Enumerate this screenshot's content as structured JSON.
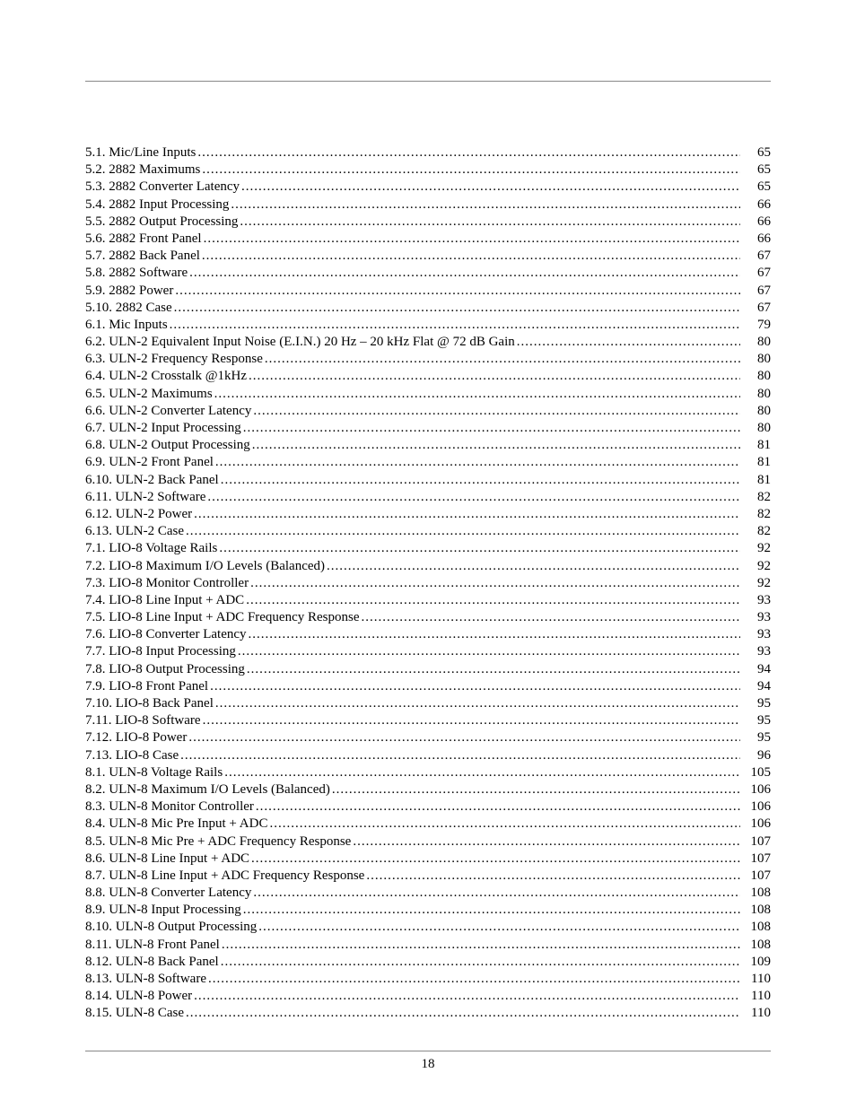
{
  "entries": [
    {
      "label": "5.1. Mic/Line Inputs",
      "page": "65"
    },
    {
      "label": "5.2. 2882 Maximums",
      "page": "65"
    },
    {
      "label": "5.3. 2882 Converter Latency",
      "page": "65"
    },
    {
      "label": "5.4. 2882 Input Processing",
      "page": "66"
    },
    {
      "label": "5.5. 2882 Output Processing",
      "page": "66"
    },
    {
      "label": "5.6. 2882 Front Panel",
      "page": "66"
    },
    {
      "label": "5.7. 2882 Back Panel",
      "page": "67"
    },
    {
      "label": "5.8. 2882 Software",
      "page": "67"
    },
    {
      "label": "5.9. 2882 Power",
      "page": "67"
    },
    {
      "label": "5.10. 2882 Case",
      "page": "67"
    },
    {
      "label": "6.1. Mic Inputs",
      "page": "79"
    },
    {
      "label": "6.2. ULN-2 Equivalent Input Noise (E.I.N.) 20 Hz – 20 kHz Flat @ 72 dB Gain",
      "page": "80"
    },
    {
      "label": "6.3. ULN-2 Frequency Response",
      "page": "80"
    },
    {
      "label": "6.4. ULN-2 Crosstalk @1kHz",
      "page": "80"
    },
    {
      "label": "6.5. ULN-2 Maximums",
      "page": "80"
    },
    {
      "label": "6.6. ULN-2 Converter Latency",
      "page": "80"
    },
    {
      "label": "6.7. ULN-2 Input Processing",
      "page": "80"
    },
    {
      "label": "6.8. ULN-2 Output Processing",
      "page": "81"
    },
    {
      "label": "6.9. ULN-2 Front Panel",
      "page": "81"
    },
    {
      "label": "6.10. ULN-2 Back Panel",
      "page": "81"
    },
    {
      "label": "6.11. ULN-2 Software",
      "page": "82"
    },
    {
      "label": "6.12. ULN-2 Power",
      "page": "82"
    },
    {
      "label": "6.13. ULN-2 Case",
      "page": "82"
    },
    {
      "label": "7.1. LIO-8 Voltage Rails",
      "page": "92"
    },
    {
      "label": "7.2. LIO-8 Maximum I/O Levels (Balanced)",
      "page": "92"
    },
    {
      "label": "7.3. LIO-8 Monitor Controller",
      "page": "92"
    },
    {
      "label": "7.4. LIO-8 Line Input + ADC",
      "page": "93"
    },
    {
      "label": "7.5. LIO-8 Line Input + ADC Frequency Response",
      "page": "93"
    },
    {
      "label": "7.6. LIO-8 Converter Latency",
      "page": "93"
    },
    {
      "label": "7.7. LIO-8 Input Processing",
      "page": "93"
    },
    {
      "label": "7.8. LIO-8 Output Processing",
      "page": "94"
    },
    {
      "label": "7.9. LIO-8 Front Panel",
      "page": "94"
    },
    {
      "label": "7.10. LIO-8 Back Panel",
      "page": "95"
    },
    {
      "label": "7.11. LIO-8 Software",
      "page": "95"
    },
    {
      "label": "7.12. LIO-8 Power",
      "page": "95"
    },
    {
      "label": "7.13. LIO-8 Case",
      "page": "96"
    },
    {
      "label": "8.1. ULN-8 Voltage Rails",
      "page": "105"
    },
    {
      "label": "8.2. ULN-8 Maximum I/O Levels (Balanced)",
      "page": "106"
    },
    {
      "label": "8.3. ULN-8 Monitor Controller",
      "page": "106"
    },
    {
      "label": "8.4. ULN-8 Mic Pre Input + ADC",
      "page": "106"
    },
    {
      "label": "8.5. ULN-8 Mic Pre + ADC Frequency Response",
      "page": "107"
    },
    {
      "label": "8.6. ULN-8 Line Input + ADC",
      "page": "107"
    },
    {
      "label": "8.7. ULN-8 Line Input + ADC Frequency Response",
      "page": "107"
    },
    {
      "label": "8.8. ULN-8 Converter Latency",
      "page": "108"
    },
    {
      "label": "8.9. ULN-8 Input Processing",
      "page": "108"
    },
    {
      "label": "8.10. ULN-8 Output Processing",
      "page": "108"
    },
    {
      "label": "8.11. ULN-8 Front Panel",
      "page": "108"
    },
    {
      "label": "8.12. ULN-8 Back Panel",
      "page": "109"
    },
    {
      "label": "8.13. ULN-8 Software",
      "page": "110"
    },
    {
      "label": "8.14. ULN-8 Power",
      "page": "110"
    },
    {
      "label": "8.15. ULN-8 Case",
      "page": "110"
    }
  ],
  "footer": {
    "page_number": "18"
  }
}
